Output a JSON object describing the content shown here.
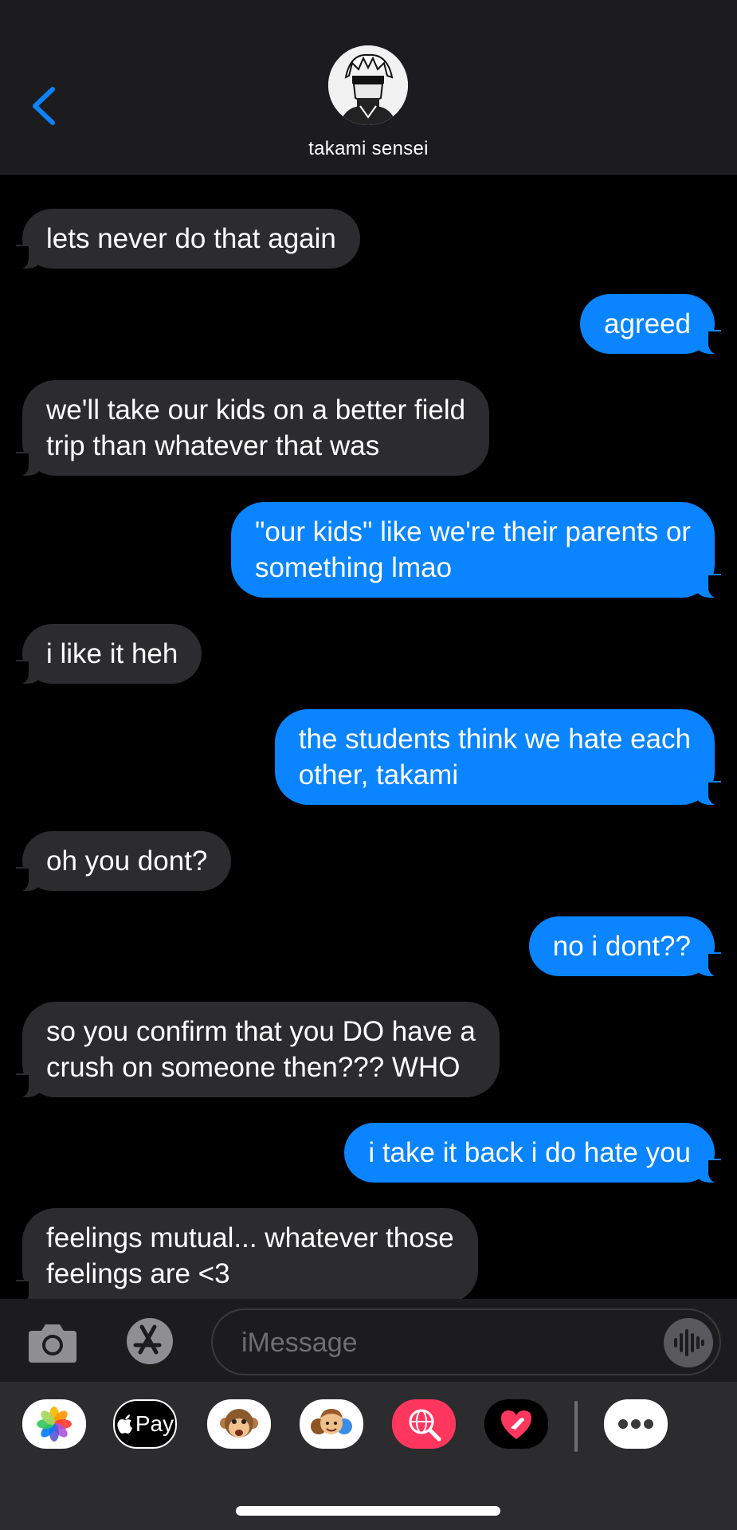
{
  "header": {
    "contact_name": "takami sensei"
  },
  "messages": [
    {
      "direction": "in",
      "text": "lets never do that again"
    },
    {
      "direction": "out",
      "text": "agreed"
    },
    {
      "direction": "in",
      "text": "we'll take our kids on a better field\ntrip than whatever that was"
    },
    {
      "direction": "out",
      "text": "\"our kids\" like we're their parents or\nsomething lmao"
    },
    {
      "direction": "in",
      "text": "i like it heh"
    },
    {
      "direction": "out",
      "text": "the students think we hate each\nother, takami"
    },
    {
      "direction": "in",
      "text": "oh you dont?"
    },
    {
      "direction": "out",
      "text": "no i dont??"
    },
    {
      "direction": "in",
      "text": "so you confirm that you DO have a\ncrush on someone then??? WHO"
    },
    {
      "direction": "out",
      "text": "i take it back i do hate you"
    },
    {
      "direction": "in",
      "text": "feelings mutual... whatever those\nfeelings are <3"
    }
  ],
  "input": {
    "placeholder": "iMessage"
  },
  "apps": {
    "apple_pay_label": "Pay"
  },
  "colors": {
    "incoming_bubble": "#2c2c2e",
    "outgoing_bubble": "#0a84ff",
    "accent": "#0a84ff"
  }
}
